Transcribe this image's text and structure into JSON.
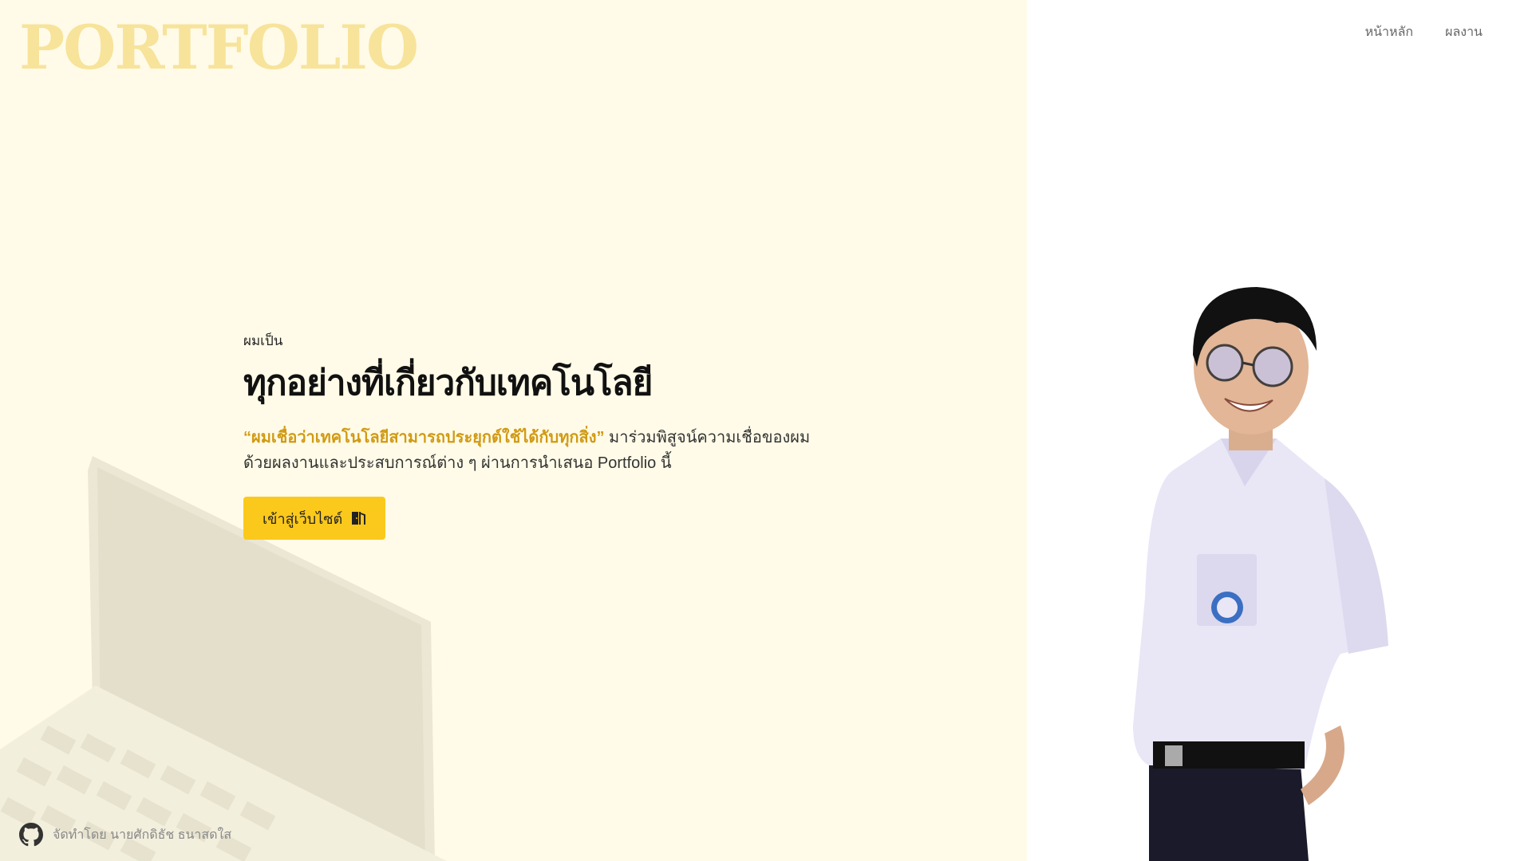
{
  "brand": {
    "logo_text": "PORTFOLIO"
  },
  "nav": {
    "items": [
      {
        "label": "หน้าหลัก"
      },
      {
        "label": "ผลงาน"
      }
    ]
  },
  "hero": {
    "intro": "ผมเป็น",
    "title": "ทุกอย่างที่เกี่ยวกับเทคโนโลยี",
    "quote": "“ผมเชื่อว่าเทคโนโลยีสามารถประยุกต์ใช้ได้กับทุกสิ่ง”",
    "desc_line1": " มาร่วมพิสูจน์ความเชื่อของผม",
    "desc_line2": "ด้วยผลงานและประสบการณ์ต่าง ๆ ผ่านการนำเสนอ Portfolio นี้",
    "cta_label": "เข้าสู่เว็บไซต์"
  },
  "footer": {
    "credit": "จัดทำโดย นายศักดิธัช ธนาสดใส"
  },
  "colors": {
    "left_bg": "#fffbe8",
    "logo": "#f7e39a",
    "accent": "#fbc91c",
    "quote": "#d19a13"
  },
  "icons": {
    "cta_icon": "door-exit-icon",
    "footer_icon": "github-icon"
  }
}
